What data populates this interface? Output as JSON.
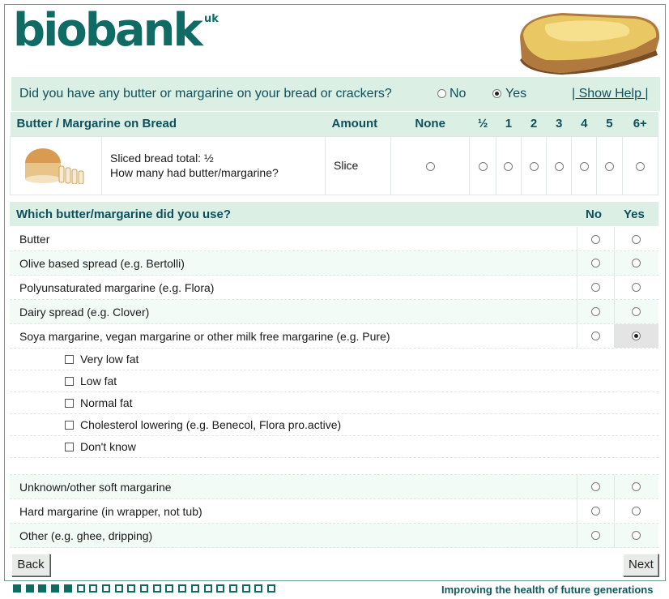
{
  "header": {
    "logo": "biobank",
    "logo_suffix": "uk"
  },
  "question": {
    "text": "Did you have any butter or margarine on your bread or crackers?",
    "options": [
      "No",
      "Yes"
    ],
    "selected": "Yes",
    "help_link": "| Show Help |"
  },
  "amount_table": {
    "headers": [
      "Butter / Margarine on Bread",
      "Amount",
      "None",
      "½",
      "1",
      "2",
      "3",
      "4",
      "5",
      "6+"
    ],
    "row": {
      "line1": "Sliced bread total: ½",
      "line2": "How many had butter/margarine?",
      "unit": "Slice"
    }
  },
  "types": {
    "title": "Which butter/margarine did you use?",
    "col_no": "No",
    "col_yes": "Yes",
    "items_top": [
      {
        "label": "Butter",
        "selected": null
      },
      {
        "label": "Olive based spread (e.g. Bertolli)",
        "selected": null
      },
      {
        "label": "Polyunsaturated margarine (e.g. Flora)",
        "selected": null
      },
      {
        "label": "Dairy spread (e.g. Clover)",
        "selected": null
      },
      {
        "label": "Soya margarine, vegan margarine or other milk free margarine (e.g. Pure)",
        "selected": "Yes"
      }
    ],
    "sub_options": [
      "Very low fat",
      "Low fat",
      "Normal fat",
      "Cholesterol lowering (e.g. Benecol, Flora pro.active)",
      "Don't know"
    ],
    "items_bottom": [
      {
        "label": "Unknown/other soft margarine",
        "selected": null
      },
      {
        "label": "Hard margarine (in wrapper, not tub)",
        "selected": null
      },
      {
        "label": "Other (e.g. ghee, dripping)",
        "selected": null
      }
    ]
  },
  "nav": {
    "back": "Back",
    "next": "Next"
  },
  "footer": {
    "progress_done": 5,
    "progress_total": 21,
    "tagline": "Improving the health of future generations"
  },
  "colors": {
    "brand": "#0f6b63",
    "header_bg": "#dcefe4",
    "text_heading": "#0e4f5c"
  }
}
